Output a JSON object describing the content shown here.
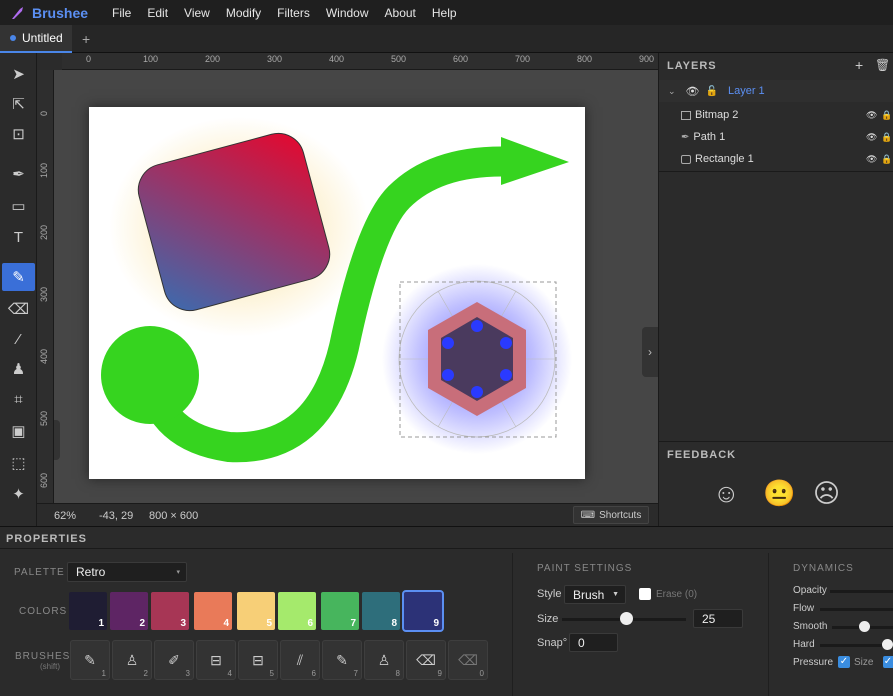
{
  "app": {
    "name": "Brushee",
    "brand_color": "#5b8ff2"
  },
  "menu": [
    "File",
    "Edit",
    "View",
    "Modify",
    "Filters",
    "Window",
    "About",
    "Help"
  ],
  "tabs": [
    {
      "label": "Untitled"
    }
  ],
  "ruler": {
    "top": [
      "0",
      "100",
      "200",
      "300",
      "400",
      "500",
      "600",
      "700",
      "800",
      "900"
    ],
    "left": [
      "0",
      "100",
      "200",
      "300",
      "400",
      "500",
      "600"
    ]
  },
  "status": {
    "zoom": "62%",
    "coords": "-43, 29",
    "size": "800 × 600",
    "shortcuts": "Shortcuts"
  },
  "layers": {
    "title": "LAYERS",
    "group": "Layer 1",
    "items": [
      {
        "label": "Bitmap 2",
        "icon": "bitmap-icon"
      },
      {
        "label": "Path 1",
        "icon": "pen-icon"
      },
      {
        "label": "Rectangle 1",
        "icon": "rect-icon"
      }
    ]
  },
  "feedback": {
    "title": "FEEDBACK"
  },
  "properties": {
    "title": "PROPERTIES",
    "palette_label": "PALETTE",
    "palette_value": "Retro",
    "colors_label": "COLORS",
    "swatches": [
      {
        "n": "1",
        "color": "#1f1d33"
      },
      {
        "n": "2",
        "color": "#5e2564"
      },
      {
        "n": "3",
        "color": "#a73655"
      },
      {
        "n": "4",
        "color": "#e97a59"
      },
      {
        "n": "5",
        "color": "#f7cf77"
      },
      {
        "n": "6",
        "color": "#a5ea6c"
      },
      {
        "n": "7",
        "color": "#47b55d"
      },
      {
        "n": "8",
        "color": "#2e6e7b"
      },
      {
        "n": "9",
        "color": "#2c3277"
      }
    ],
    "brushes_label": "BRUSHES",
    "brushes_sub": "(shift)",
    "brushes": [
      "1",
      "2",
      "3",
      "4",
      "5",
      "6",
      "7",
      "8",
      "9",
      "0"
    ]
  },
  "paint_settings": {
    "title": "PAINT SETTINGS",
    "style_label": "Style",
    "style_value": "Brush",
    "erase_label": "Erase (0)",
    "size_label": "Size",
    "size_value": "25",
    "snap_label": "Snap°",
    "snap_value": "0"
  },
  "dynamics": {
    "title": "DYNAMICS",
    "opacity": "Opacity",
    "flow": "Flow",
    "smooth": "Smooth",
    "hard": "Hard",
    "pressure": "Pressure",
    "size": "Size"
  }
}
